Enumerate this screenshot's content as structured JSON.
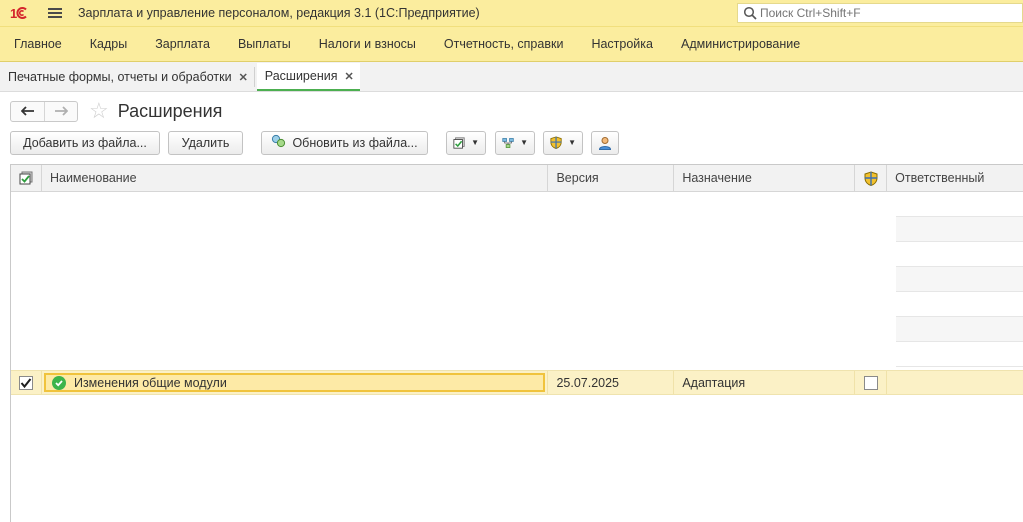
{
  "app": {
    "title": "Зарплата и управление персоналом, редакция 3.1  (1С:Предприятие)",
    "logo_text": "1С",
    "search_placeholder": "Поиск Ctrl+Shift+F"
  },
  "menu": {
    "items": [
      "Главное",
      "Кадры",
      "Зарплата",
      "Выплаты",
      "Налоги и взносы",
      "Отчетность, справки",
      "Настройка",
      "Администрирование"
    ]
  },
  "tabs": [
    {
      "label": "Печатные формы, отчеты и обработки",
      "active": false
    },
    {
      "label": "Расширения",
      "active": true
    }
  ],
  "form": {
    "title": "Расширения",
    "nav_back": "🡐",
    "nav_forward": "🡒",
    "favorite": "☆"
  },
  "toolbar": {
    "add_label": "Добавить из файла...",
    "delete_label": "Удалить",
    "update_label": "Обновить из файла..."
  },
  "grid": {
    "columns": {
      "name": "Наименование",
      "version": "Версия",
      "purpose": "Назначение",
      "responsible": "Ответственный"
    },
    "rows": [
      {
        "active": true,
        "name": "Изменения общие модули",
        "version": "25.07.2025",
        "purpose": "Адаптация",
        "safe_mode": false,
        "responsible": ""
      }
    ]
  },
  "colors": {
    "accent_yellow": "#fbed9e",
    "selection": "#fdeaa6",
    "selection_border": "#f0c33c",
    "active_tab_underline": "#4caf50",
    "ok_green": "#3cb44b"
  }
}
